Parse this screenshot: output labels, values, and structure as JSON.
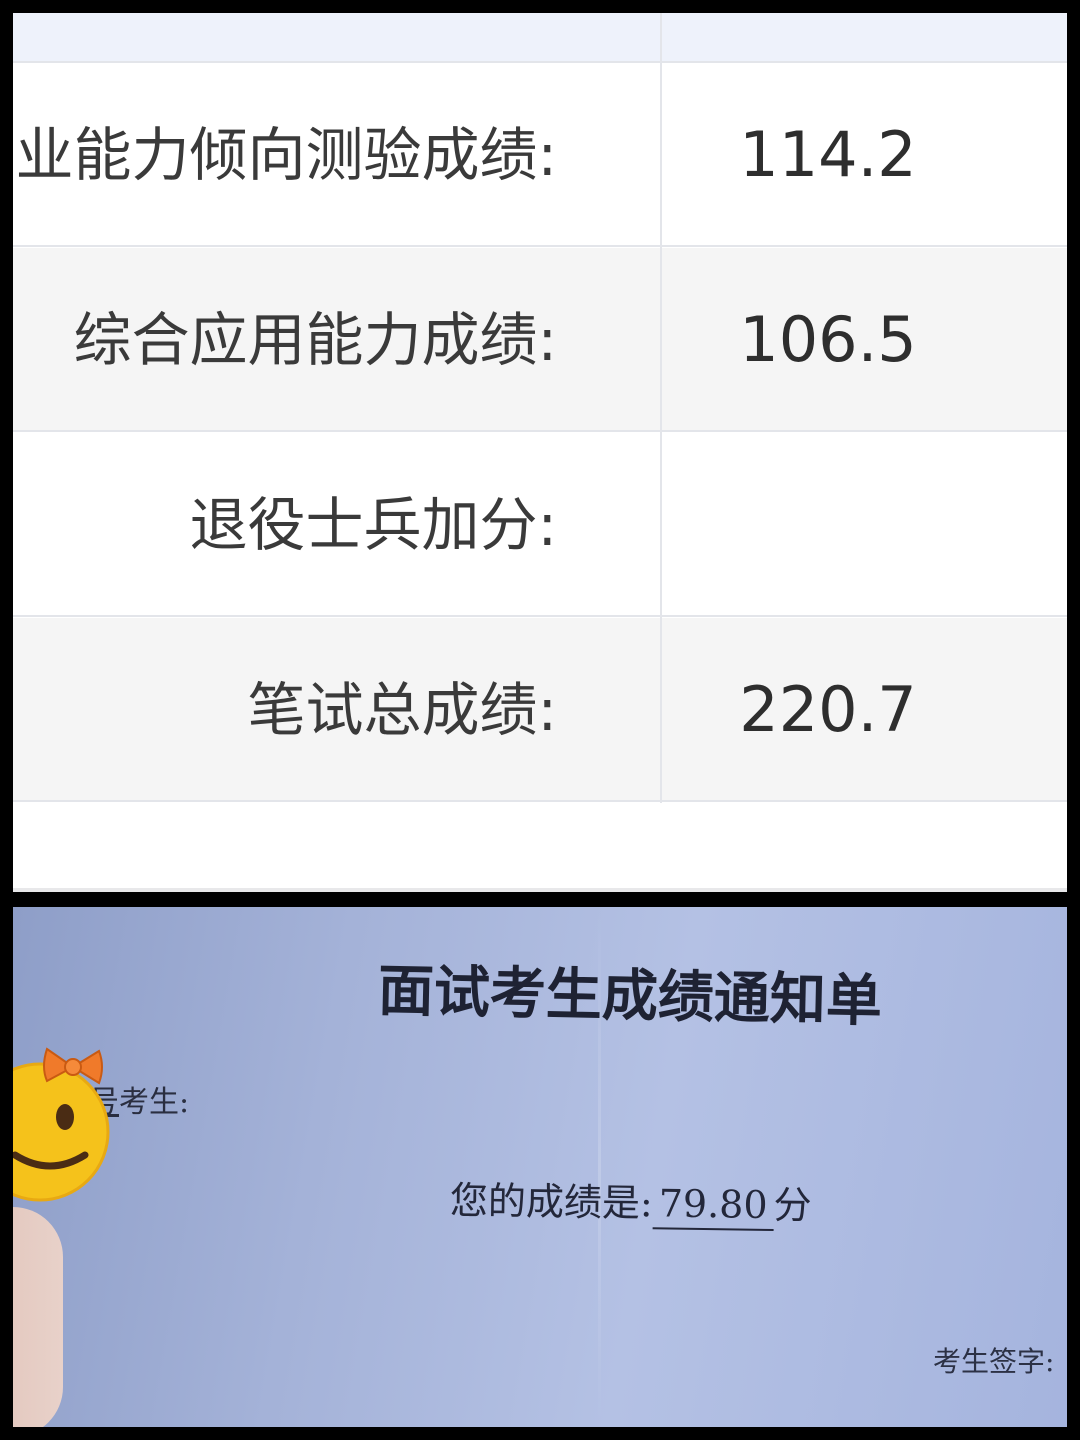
{
  "score_table": {
    "rows": [
      {
        "label": "业能力倾向测验成绩:",
        "value": "114.2"
      },
      {
        "label": "综合应用能力成绩:",
        "value": "106.5"
      },
      {
        "label": "退役士兵加分:",
        "value": ""
      },
      {
        "label": "笔试总成绩:",
        "value": "220.7"
      }
    ]
  },
  "notice": {
    "title": "面试考生成绩通知单",
    "examinee_prefix": "号",
    "examinee_label": "考生:",
    "score_prefix": "您的成绩是:",
    "score_value": "79.80",
    "score_unit": "分",
    "signature_label": "考生签字:"
  },
  "sticker": {
    "icon": "smiling-face-with-bow-emoji"
  },
  "colors": {
    "table_header_bg": "#eef2fb",
    "row_alt_bg": "#f5f5f5",
    "border": "#e3e5ea",
    "paper": "#a4b2d8",
    "emoji_yellow": "#f5c21b",
    "bow_orange": "#f07a2a"
  }
}
